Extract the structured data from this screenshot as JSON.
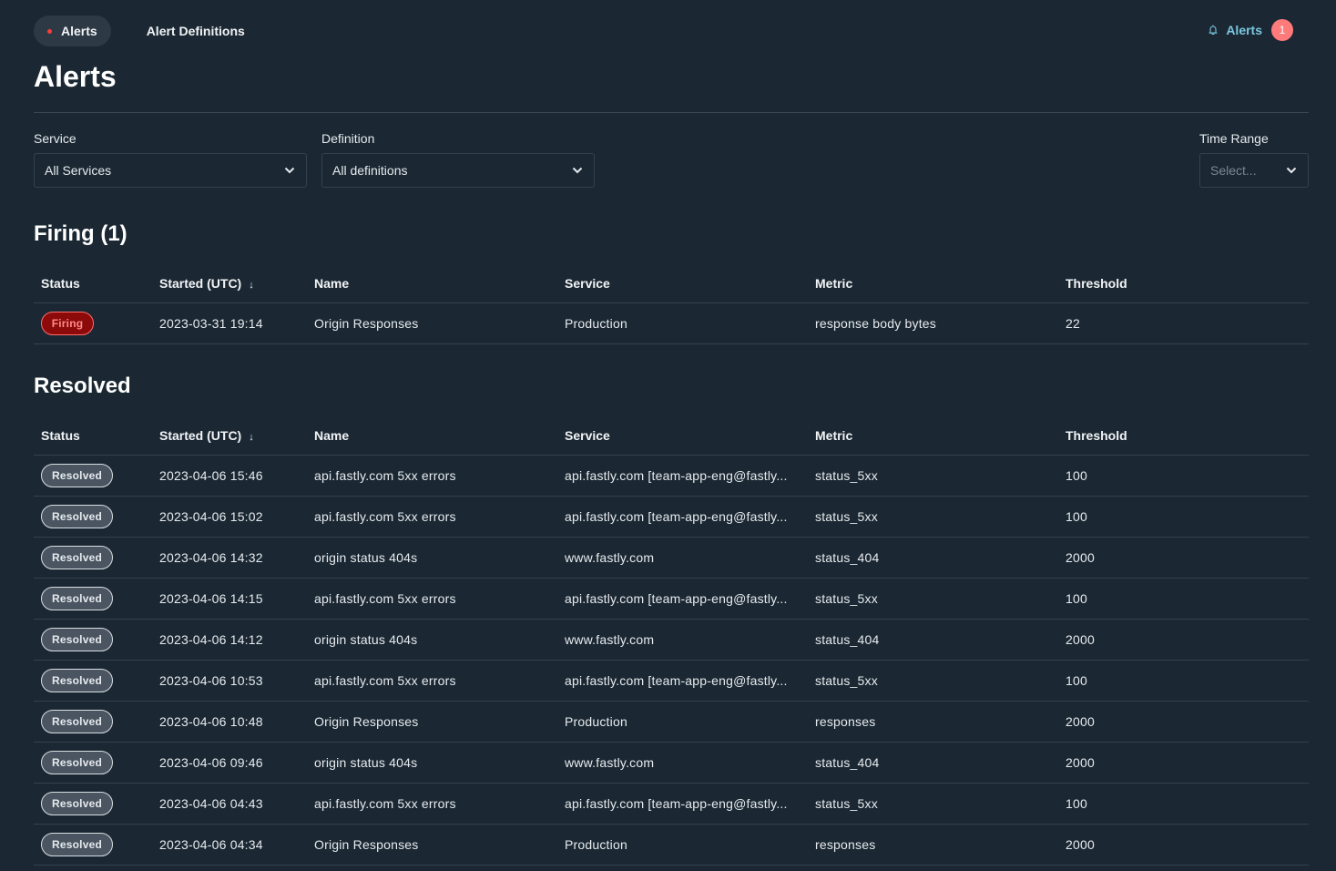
{
  "nav": {
    "tabs": [
      {
        "label": "Alerts",
        "active": true
      },
      {
        "label": "Alert Definitions",
        "active": false
      }
    ],
    "alerts_link": {
      "label": "Alerts",
      "count": "1"
    }
  },
  "colors": {
    "background": "#1b2833",
    "accent": "#7cc6e0",
    "firing": "#8c0a0a",
    "alert_count": "#ff7b7b"
  },
  "page": {
    "title": "Alerts"
  },
  "filters": {
    "service": {
      "label": "Service",
      "value": "All Services"
    },
    "definition": {
      "label": "Definition",
      "value": "All definitions"
    },
    "time_range": {
      "label": "Time Range",
      "placeholder": "Select..."
    }
  },
  "columns": [
    "Status",
    "Started (UTC)",
    "Name",
    "Service",
    "Metric",
    "Threshold"
  ],
  "firing": {
    "title": "Firing (1)",
    "rows": [
      {
        "status": "Firing",
        "started": "2023-03-31 19:14",
        "name": "Origin Responses",
        "service": "Production",
        "metric": "response body bytes",
        "threshold": "22"
      }
    ]
  },
  "resolved": {
    "title": "Resolved",
    "rows": [
      {
        "status": "Resolved",
        "started": "2023-04-06 15:46",
        "name": "api.fastly.com 5xx errors",
        "service": "api.fastly.com [team-app-eng@fastly...",
        "metric": "status_5xx",
        "threshold": "100"
      },
      {
        "status": "Resolved",
        "started": "2023-04-06 15:02",
        "name": "api.fastly.com 5xx errors",
        "service": "api.fastly.com [team-app-eng@fastly...",
        "metric": "status_5xx",
        "threshold": "100"
      },
      {
        "status": "Resolved",
        "started": "2023-04-06 14:32",
        "name": "origin status 404s",
        "service": "www.fastly.com",
        "metric": "status_404",
        "threshold": "2000"
      },
      {
        "status": "Resolved",
        "started": "2023-04-06 14:15",
        "name": "api.fastly.com 5xx errors",
        "service": "api.fastly.com [team-app-eng@fastly...",
        "metric": "status_5xx",
        "threshold": "100"
      },
      {
        "status": "Resolved",
        "started": "2023-04-06 14:12",
        "name": "origin status 404s",
        "service": "www.fastly.com",
        "metric": "status_404",
        "threshold": "2000"
      },
      {
        "status": "Resolved",
        "started": "2023-04-06 10:53",
        "name": "api.fastly.com 5xx errors",
        "service": "api.fastly.com [team-app-eng@fastly...",
        "metric": "status_5xx",
        "threshold": "100"
      },
      {
        "status": "Resolved",
        "started": "2023-04-06 10:48",
        "name": "Origin Responses",
        "service": "Production",
        "metric": "responses",
        "threshold": "2000"
      },
      {
        "status": "Resolved",
        "started": "2023-04-06 09:46",
        "name": "origin status 404s",
        "service": "www.fastly.com",
        "metric": "status_404",
        "threshold": "2000"
      },
      {
        "status": "Resolved",
        "started": "2023-04-06 04:43",
        "name": "api.fastly.com 5xx errors",
        "service": "api.fastly.com [team-app-eng@fastly...",
        "metric": "status_5xx",
        "threshold": "100"
      },
      {
        "status": "Resolved",
        "started": "2023-04-06 04:34",
        "name": "Origin Responses",
        "service": "Production",
        "metric": "responses",
        "threshold": "2000"
      }
    ]
  }
}
